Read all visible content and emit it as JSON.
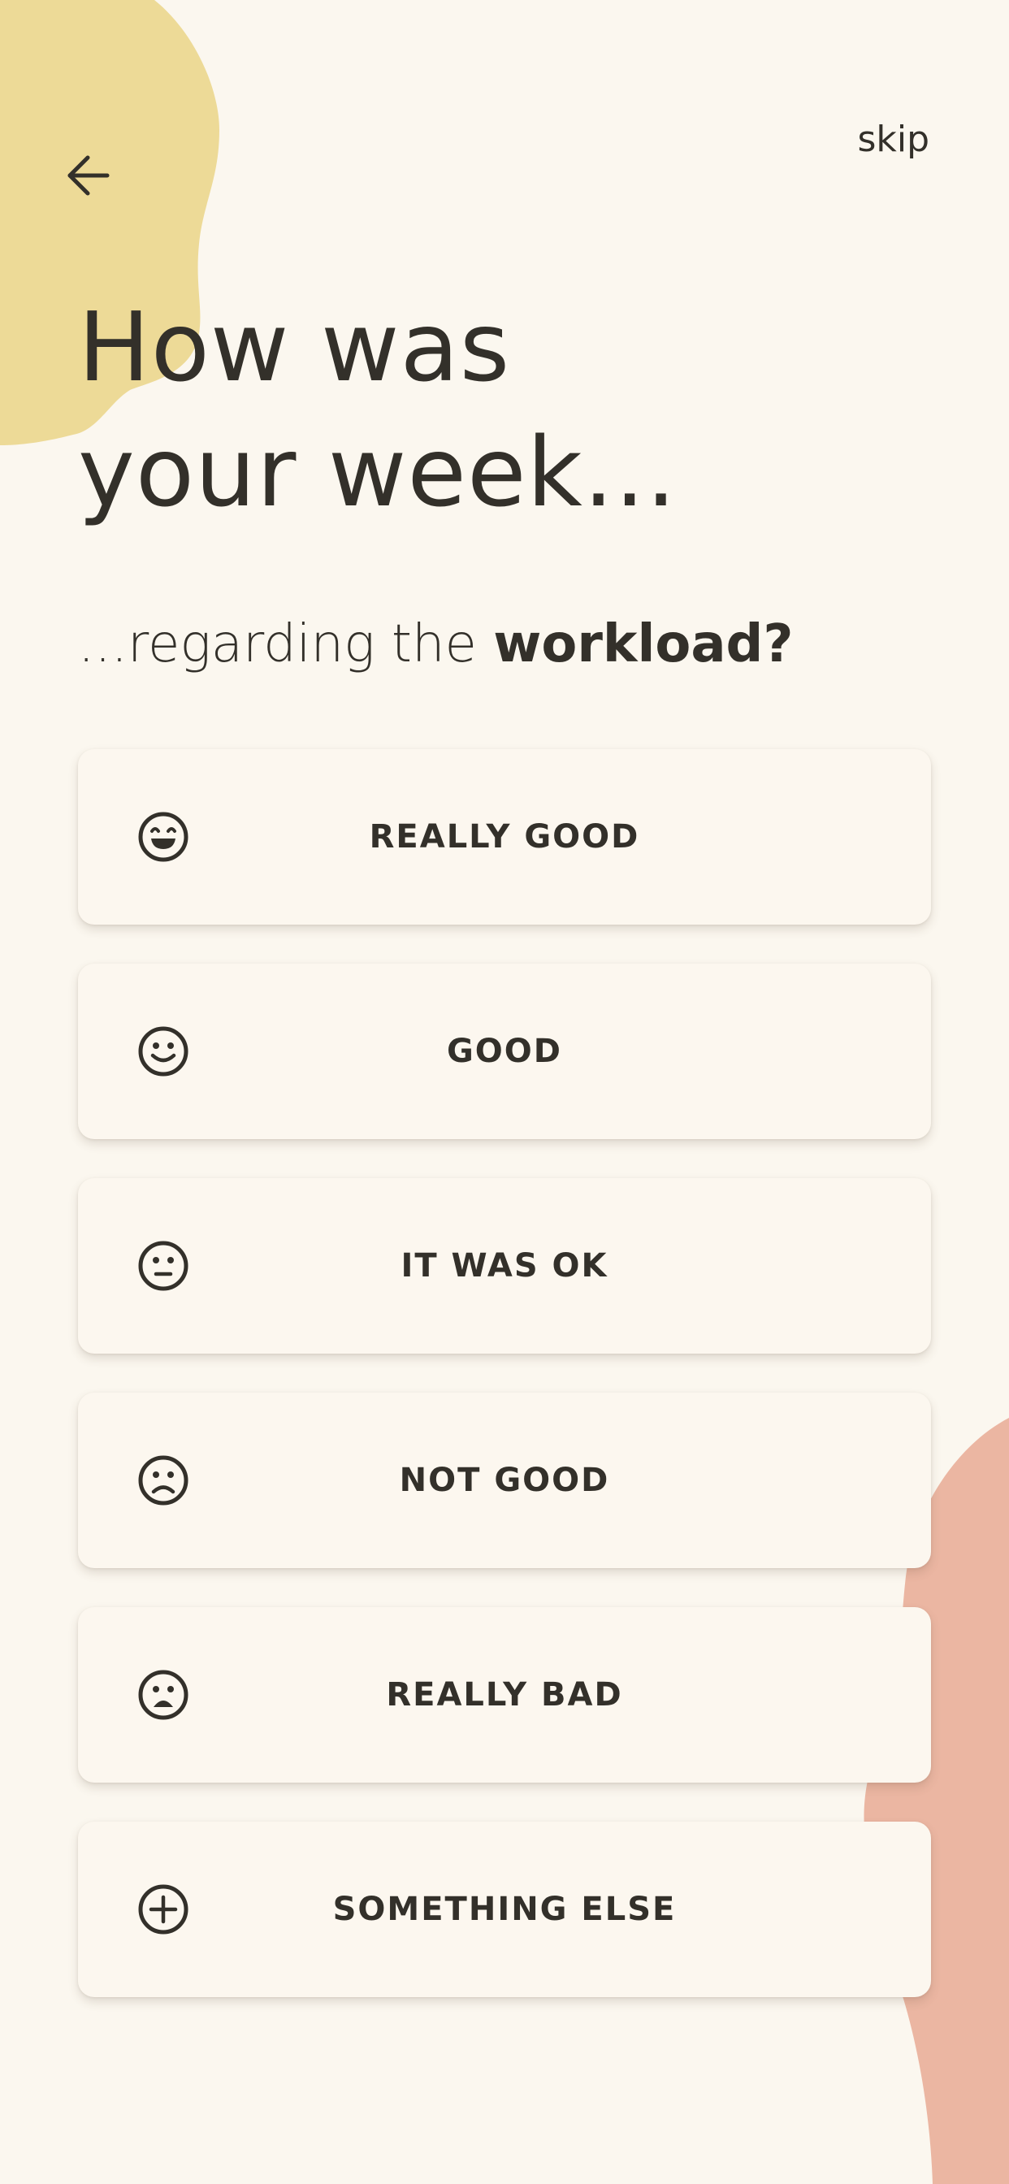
{
  "header": {
    "back_icon": "arrow-left-icon",
    "skip_label": "skip"
  },
  "title": {
    "line1": "How was",
    "line2": "your week..."
  },
  "subtitle": {
    "prefix": "...regarding the ",
    "emphasis": "workload?"
  },
  "options": [
    {
      "label": "REALLY GOOD",
      "icon": "grinning-face-icon"
    },
    {
      "label": "GOOD",
      "icon": "smiling-face-icon"
    },
    {
      "label": "IT WAS OK",
      "icon": "neutral-face-icon"
    },
    {
      "label": "NOT GOOD",
      "icon": "frowning-face-icon"
    },
    {
      "label": "REALLY BAD",
      "icon": "upset-face-icon"
    },
    {
      "label": "SOMETHING ELSE",
      "icon": "plus-circle-icon"
    }
  ],
  "colors": {
    "background": "#FBF7EF",
    "yellow_blob": "#EDDA97",
    "pink_blob": "#EBB6A2",
    "text": "#33302A"
  }
}
